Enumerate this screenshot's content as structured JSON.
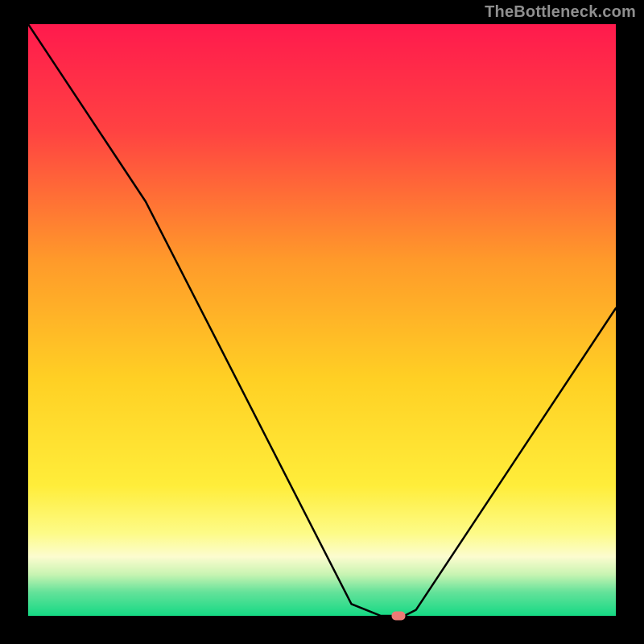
{
  "watermark": "TheBottleneck.com",
  "chart_data": {
    "type": "line",
    "title": "",
    "xlabel": "",
    "ylabel": "",
    "xlim": [
      0,
      100
    ],
    "ylim": [
      0,
      100
    ],
    "grid": false,
    "legend": false,
    "series": [
      {
        "name": "bottleneck-curve",
        "x": [
          0,
          20,
          55,
          60,
          64,
          66,
          100
        ],
        "values": [
          100,
          70,
          2,
          0,
          0,
          1,
          52
        ]
      }
    ],
    "marker": {
      "x": 63,
      "y": 0,
      "color": "#ed7b76"
    },
    "background_gradient": {
      "stops": [
        {
          "offset": 0,
          "color": "#ff1a4d"
        },
        {
          "offset": 0.18,
          "color": "#ff4242"
        },
        {
          "offset": 0.4,
          "color": "#ff9a2a"
        },
        {
          "offset": 0.6,
          "color": "#ffd024"
        },
        {
          "offset": 0.78,
          "color": "#ffed3a"
        },
        {
          "offset": 0.86,
          "color": "#fdfb87"
        },
        {
          "offset": 0.9,
          "color": "#fcfccf"
        },
        {
          "offset": 0.93,
          "color": "#c8f4b2"
        },
        {
          "offset": 0.96,
          "color": "#64e29a"
        },
        {
          "offset": 1.0,
          "color": "#15d984"
        }
      ]
    }
  }
}
